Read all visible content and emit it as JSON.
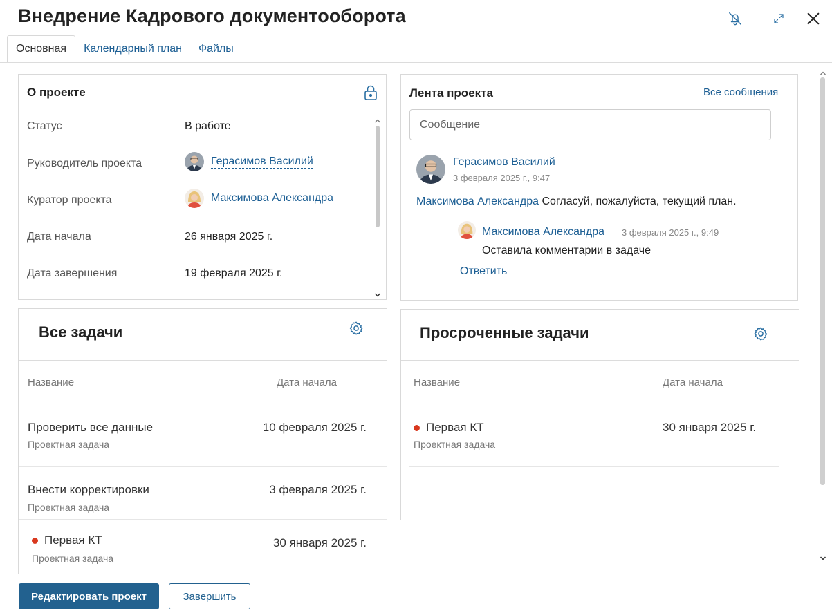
{
  "header": {
    "title": "Внедрение Кадрового документооборота",
    "icons": [
      "bell-off-icon",
      "expand-icon",
      "close-icon"
    ]
  },
  "tabs": [
    {
      "label": "Основная",
      "active": true
    },
    {
      "label": "Календарный план",
      "active": false
    },
    {
      "label": "Файлы",
      "active": false
    }
  ],
  "about": {
    "title": "О проекте",
    "rows": [
      {
        "label": "Статус",
        "value": "В работе"
      },
      {
        "label": "Руководитель проекта",
        "value": "Герасимов Василий"
      },
      {
        "label": "Куратор проекта",
        "value": "Максимова Александра"
      },
      {
        "label": "Дата начала",
        "value": "26 января 2025 г."
      },
      {
        "label": "Дата завершения",
        "value": "19 февраля 2025 г."
      }
    ]
  },
  "feed": {
    "title": "Лента проекта",
    "all_messages": "Все сообщения",
    "input_placeholder": "Сообщение",
    "post": {
      "author": "Герасимов Василий",
      "time": "3 февраля 2025 г., 9:47",
      "mention": "Максимова Александра",
      "text": " Согласуй, пожалуйста, текущий план."
    },
    "reply": {
      "author": "Максимова Александра",
      "time": "3 февраля 2025 г., 9:49",
      "text": "Оставила комментарии в задаче"
    },
    "reply_action": "Ответить"
  },
  "all_tasks": {
    "title": "Все задачи",
    "columns": [
      "Название",
      "Дата начала"
    ],
    "rows": [
      {
        "name": "Проверить все данные",
        "type": "Проектная задача",
        "date": "10 февраля 2025 г.",
        "overdue": false
      },
      {
        "name": "Внести корректировки",
        "type": "Проектная задача",
        "date": "3 февраля 2025 г.",
        "overdue": false
      },
      {
        "name": "Первая КТ",
        "type": "Проектная задача",
        "date": "30 января 2025 г.",
        "overdue": true
      }
    ]
  },
  "overdue_tasks": {
    "title": "Просроченные задачи",
    "columns": [
      "Название",
      "Дата начала"
    ],
    "rows": [
      {
        "name": "Первая КТ",
        "type": "Проектная задача",
        "date": "30 января 2025 г.",
        "overdue": true
      }
    ]
  },
  "footer": {
    "edit_label": "Редактировать проект",
    "finish_label": "Завершить"
  },
  "colors": {
    "link": "#1d5f94",
    "primary_button": "#22618f",
    "overdue_dot": "#d9381e"
  }
}
